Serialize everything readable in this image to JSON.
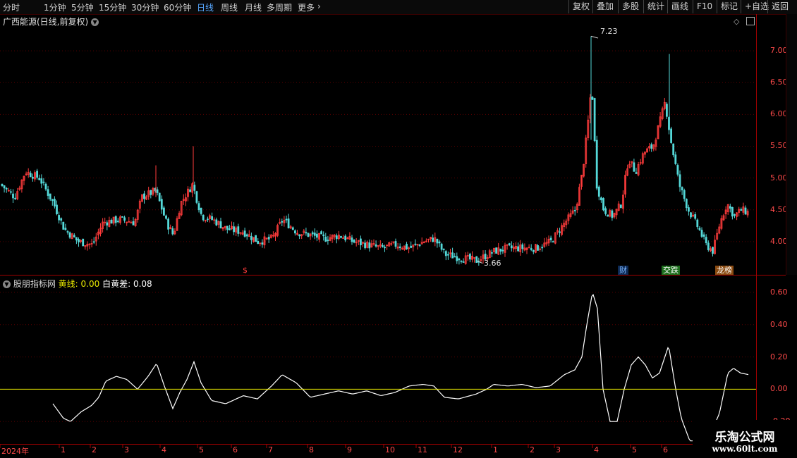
{
  "toolbar": {
    "timeframes": [
      "分时",
      "1分钟",
      "5分钟",
      "15分钟",
      "30分钟",
      "60分钟",
      "日线",
      "周线",
      "月线",
      "多周期",
      "更多"
    ],
    "active": "日线",
    "right_buttons": [
      "复权",
      "叠加",
      "多股",
      "统计",
      "画线",
      "F10",
      "标记",
      "+自选",
      "返回"
    ]
  },
  "chart": {
    "title": "广西能源(日线,前复权)",
    "price_labels": [
      "7.00",
      "6.50",
      "6.00",
      "5.50",
      "5.00",
      "4.50",
      "4.00"
    ],
    "high_label": "7.23",
    "low_label": "3.66",
    "badges": [
      {
        "text": "$",
        "color": "#ff3b3b",
        "bg": "#000"
      },
      {
        "text": "财",
        "color": "#7fb7ff",
        "bg": "#0d2a55"
      },
      {
        "text": "交跌",
        "color": "#ffffff",
        "bg": "#1c6d1c"
      },
      {
        "text": "龙榜",
        "color": "#ffffff",
        "bg": "#8a4a10"
      }
    ]
  },
  "indicator": {
    "name": "股朋指标网",
    "yellow_label": "黄线:",
    "yellow_value": "0.00",
    "white_label": "白黄差:",
    "white_value": "0.08",
    "y_labels": [
      "0.60",
      "0.40",
      "0.20",
      "0.00",
      "-0.20"
    ]
  },
  "axis": {
    "months": [
      "2024年",
      "1",
      "2",
      "3",
      "4",
      "5",
      "6",
      "7",
      "8",
      "9",
      "10",
      "11",
      "12",
      "1",
      "2",
      "3",
      "4",
      "5",
      "6"
    ]
  },
  "watermark": {
    "line1": "乐淘公式网",
    "line2": "www.60lt.com"
  },
  "colors": {
    "up": "#ff3b3b",
    "down": "#54d8d8",
    "yellow": "#e8e800",
    "grid": "#5a0000",
    "axis": "#a00000"
  },
  "chart_data": {
    "type": "candlestick",
    "price_ylim": [
      3.5,
      7.4
    ],
    "close_anchors": [
      [
        0,
        4.9
      ],
      [
        20,
        4.7
      ],
      [
        35,
        5.1
      ],
      [
        55,
        5.0
      ],
      [
        75,
        4.6
      ],
      [
        90,
        4.2
      ],
      [
        110,
        4.0
      ],
      [
        130,
        3.95
      ],
      [
        145,
        4.3
      ],
      [
        170,
        4.35
      ],
      [
        190,
        4.3
      ],
      [
        200,
        4.7
      ],
      [
        220,
        4.8
      ],
      [
        235,
        4.3
      ],
      [
        245,
        4.1
      ],
      [
        255,
        4.6
      ],
      [
        272,
        4.9
      ],
      [
        285,
        4.4
      ],
      [
        300,
        4.35
      ],
      [
        320,
        4.2
      ],
      [
        345,
        4.15
      ],
      [
        365,
        4.0
      ],
      [
        385,
        4.05
      ],
      [
        400,
        4.35
      ],
      [
        420,
        4.15
      ],
      [
        440,
        4.1
      ],
      [
        460,
        4.05
      ],
      [
        480,
        4.1
      ],
      [
        500,
        4.0
      ],
      [
        520,
        3.95
      ],
      [
        540,
        3.9
      ],
      [
        560,
        3.95
      ],
      [
        580,
        3.9
      ],
      [
        600,
        4.0
      ],
      [
        615,
        4.05
      ],
      [
        630,
        3.8
      ],
      [
        650,
        3.75
      ],
      [
        675,
        3.7
      ],
      [
        700,
        3.85
      ],
      [
        720,
        3.9
      ],
      [
        740,
        3.9
      ],
      [
        760,
        3.9
      ],
      [
        780,
        4.0
      ],
      [
        800,
        4.3
      ],
      [
        815,
        4.5
      ],
      [
        825,
        5.1
      ],
      [
        832,
        5.8
      ],
      [
        838,
        6.5
      ],
      [
        845,
        4.9
      ],
      [
        855,
        4.5
      ],
      [
        868,
        4.4
      ],
      [
        880,
        4.6
      ],
      [
        890,
        5.3
      ],
      [
        900,
        5.1
      ],
      [
        912,
        5.4
      ],
      [
        925,
        5.5
      ],
      [
        935,
        5.9
      ],
      [
        942,
        6.2
      ],
      [
        950,
        5.6
      ],
      [
        962,
        4.9
      ],
      [
        975,
        4.5
      ],
      [
        990,
        4.2
      ],
      [
        1000,
        3.95
      ],
      [
        1010,
        3.85
      ],
      [
        1020,
        4.3
      ],
      [
        1030,
        4.6
      ],
      [
        1040,
        4.4
      ],
      [
        1050,
        4.5
      ],
      [
        1062,
        4.45
      ]
    ],
    "indicator_ylim": [
      -0.33,
      0.7
    ],
    "white_line_anchors": [
      [
        75,
        -0.09
      ],
      [
        90,
        -0.18
      ],
      [
        100,
        -0.2
      ],
      [
        115,
        -0.14
      ],
      [
        130,
        -0.1
      ],
      [
        140,
        -0.05
      ],
      [
        150,
        0.05
      ],
      [
        165,
        0.08
      ],
      [
        180,
        0.06
      ],
      [
        195,
        0.0
      ],
      [
        210,
        0.08
      ],
      [
        222,
        0.16
      ],
      [
        233,
        0.02
      ],
      [
        245,
        -0.12
      ],
      [
        255,
        -0.02
      ],
      [
        265,
        0.06
      ],
      [
        275,
        0.17
      ],
      [
        285,
        0.04
      ],
      [
        300,
        -0.07
      ],
      [
        320,
        -0.09
      ],
      [
        345,
        -0.04
      ],
      [
        365,
        -0.06
      ],
      [
        385,
        0.02
      ],
      [
        400,
        0.09
      ],
      [
        420,
        0.04
      ],
      [
        440,
        -0.05
      ],
      [
        460,
        -0.03
      ],
      [
        480,
        -0.01
      ],
      [
        500,
        -0.03
      ],
      [
        520,
        -0.01
      ],
      [
        540,
        -0.04
      ],
      [
        560,
        -0.02
      ],
      [
        580,
        0.02
      ],
      [
        600,
        0.03
      ],
      [
        615,
        0.02
      ],
      [
        630,
        -0.05
      ],
      [
        650,
        -0.06
      ],
      [
        675,
        -0.03
      ],
      [
        690,
        0.0
      ],
      [
        700,
        0.03
      ],
      [
        720,
        0.02
      ],
      [
        740,
        0.03
      ],
      [
        760,
        0.01
      ],
      [
        780,
        0.02
      ],
      [
        800,
        0.09
      ],
      [
        815,
        0.12
      ],
      [
        825,
        0.2
      ],
      [
        832,
        0.4
      ],
      [
        840,
        0.6
      ],
      [
        847,
        0.5
      ],
      [
        855,
        0.0
      ],
      [
        865,
        -0.2
      ],
      [
        875,
        -0.2
      ],
      [
        885,
        0.0
      ],
      [
        895,
        0.15
      ],
      [
        905,
        0.2
      ],
      [
        915,
        0.15
      ],
      [
        925,
        0.07
      ],
      [
        935,
        0.1
      ],
      [
        948,
        0.27
      ],
      [
        958,
        0.0
      ],
      [
        966,
        -0.18
      ],
      [
        978,
        -0.32
      ],
      [
        1000,
        -0.32
      ],
      [
        1010,
        -0.25
      ],
      [
        1020,
        -0.15
      ],
      [
        1032,
        0.1
      ],
      [
        1040,
        0.13
      ],
      [
        1050,
        0.1
      ],
      [
        1062,
        0.09
      ]
    ]
  }
}
